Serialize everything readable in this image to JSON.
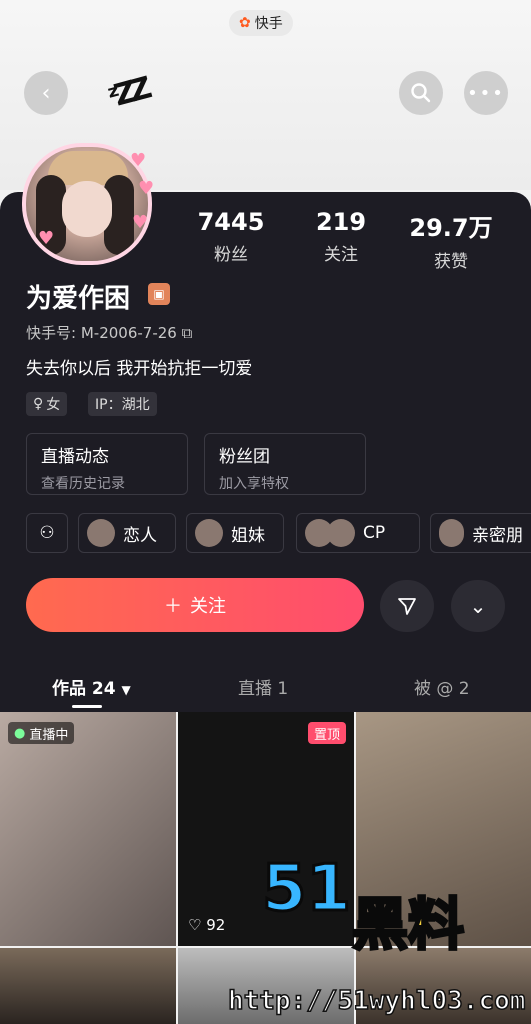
{
  "app": {
    "name": "快手"
  },
  "header": {
    "back_icon": "back-icon",
    "search_icon": "search-icon",
    "more_icon": "more-icon"
  },
  "profile": {
    "name": "为爱作困",
    "id_label": "快手号:",
    "id_value": "M-2006-7-26",
    "bio": "失去你以后 我开始抗拒一切爱",
    "gender_tag": "女",
    "ip_tag": "IP：湖北"
  },
  "stats": [
    {
      "value": "7445",
      "label": "粉丝"
    },
    {
      "value": "219",
      "label": "关注"
    },
    {
      "value": "29.7万",
      "label": "获赞"
    }
  ],
  "cards": [
    {
      "title": "直播动态",
      "subtitle": "查看历史记录"
    },
    {
      "title": "粉丝团",
      "subtitle": "加入享特权"
    }
  ],
  "relations": [
    "恋人",
    "姐妹",
    "CP",
    "亲密朋"
  ],
  "actions": {
    "follow_label": "关注"
  },
  "tabs": [
    {
      "label": "作品 24"
    },
    {
      "label": "直播 1"
    },
    {
      "label": "被 @ 2"
    }
  ],
  "grid": {
    "live_badge": "直播中",
    "pin_badge": "置顶",
    "likes": "92"
  },
  "watermark": {
    "brand_num": "51",
    "brand_text": "黑料",
    "url": "http://51wyhl03.com"
  },
  "colors": {
    "accent": "#ff4d6d",
    "panel_bg": "#1d1c24"
  }
}
